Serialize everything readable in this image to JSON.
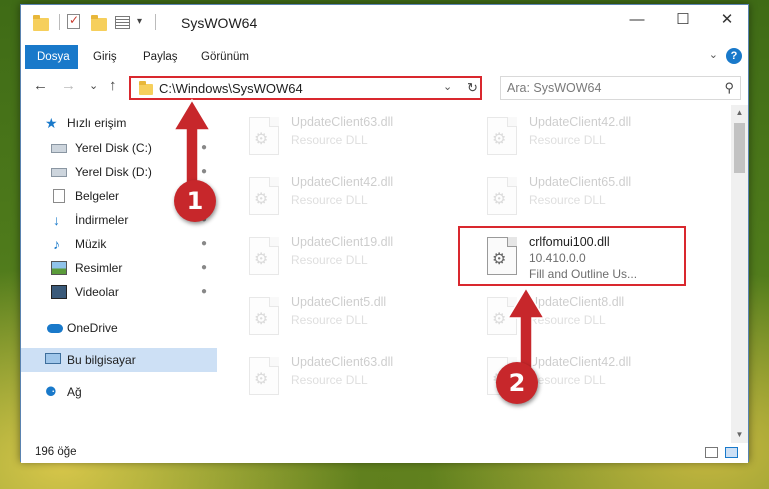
{
  "window": {
    "title": "SysWOW64",
    "controls": {
      "minimize": "—",
      "maximize": "☐",
      "close": "✕"
    }
  },
  "ribbon": {
    "tabs": [
      "Dosya",
      "Giriş",
      "Paylaş",
      "Görünüm"
    ],
    "active_tab": "Dosya",
    "expand_glyph": "⌄",
    "help_glyph": "?"
  },
  "nav": {
    "back_glyph": "←",
    "forward_glyph": "→",
    "recent_glyph": "⌄",
    "up_glyph": "↑",
    "address": "C:\\Windows\\SysWOW64",
    "address_dropdown_glyph": "⌄",
    "refresh_glyph": "↻",
    "search_placeholder": "Ara: SysWOW64",
    "search_glyph": "⚲"
  },
  "sidebar": {
    "items": [
      {
        "label": "Hızlı erişim",
        "icon": "star-icon",
        "indent": 0,
        "pinned": false
      },
      {
        "label": "Yerel Disk (C:)",
        "icon": "drive-icon",
        "indent": 1,
        "pinned": true
      },
      {
        "label": "Yerel Disk (D:)",
        "icon": "drive-icon",
        "indent": 1,
        "pinned": true
      },
      {
        "label": "Belgeler",
        "icon": "documents-icon",
        "indent": 1,
        "pinned": true
      },
      {
        "label": "İndirmeler",
        "icon": "downloads-icon",
        "indent": 1,
        "pinned": true
      },
      {
        "label": "Müzik",
        "icon": "music-icon",
        "indent": 1,
        "pinned": true
      },
      {
        "label": "Resimler",
        "icon": "pictures-icon",
        "indent": 1,
        "pinned": true
      },
      {
        "label": "Videolar",
        "icon": "videos-icon",
        "indent": 1,
        "pinned": true
      },
      {
        "label": "OneDrive",
        "icon": "onedrive-icon",
        "indent": 0,
        "pinned": false
      },
      {
        "label": "Bu bilgisayar",
        "icon": "this-pc-icon",
        "indent": 0,
        "pinned": false,
        "selected": true
      },
      {
        "label": "Ağ",
        "icon": "network-icon",
        "indent": 0,
        "pinned": false
      }
    ],
    "pin_glyph": "📌"
  },
  "files": [
    {
      "name": "UpdateClient63.dll",
      "type": "Resource DLL",
      "faded": true
    },
    {
      "name": "UpdateClient42.dll",
      "type": "Resource DLL",
      "faded": true
    },
    {
      "name": "UpdateClient42.dll",
      "type": "Resource DLL",
      "faded": true
    },
    {
      "name": "UpdateClient65.dll",
      "type": "Resource DLL",
      "faded": true
    },
    {
      "name": "UpdateClient19.dll",
      "type": "Resource DLL",
      "faded": true
    },
    {
      "name": "crlfomui100.dll",
      "version": "10.410.0.0",
      "type": "Fill and Outline Us...",
      "faded": false,
      "highlighted": true
    },
    {
      "name": "UpdateClient5.dll",
      "type": "Resource DLL",
      "faded": true
    },
    {
      "name": "UpdateClient8.dll",
      "type": "Resource DLL",
      "faded": true
    },
    {
      "name": "UpdateClient63.dll",
      "type": "Resource DLL",
      "faded": true
    },
    {
      "name": "UpdateClient42.dll",
      "type": "Resource DLL",
      "faded": true
    }
  ],
  "annotations": {
    "marker_1": "1",
    "marker_2": "2",
    "color": "#c7272b"
  },
  "status": {
    "item_count": "196 öğe"
  },
  "colors": {
    "accent": "#1979ca",
    "highlight_border": "#d9282e",
    "selected_bg": "#cde0f5"
  }
}
